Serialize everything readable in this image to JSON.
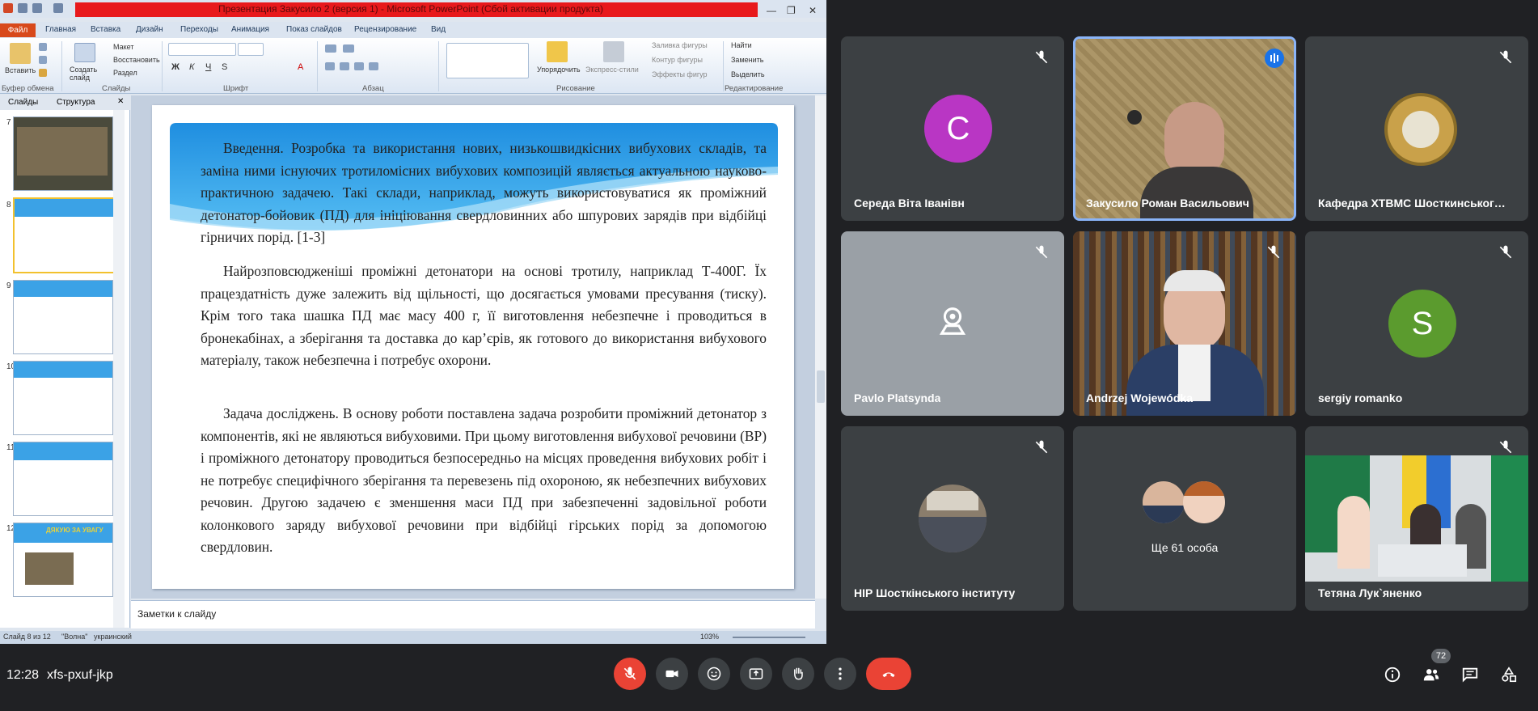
{
  "ppt": {
    "title": "Презентация Закусило 2 (версия 1) - Microsoft PowerPoint (Сбой активации продукта)",
    "file_tab": "Файл",
    "tabs": [
      "Главная",
      "Вставка",
      "Дизайн",
      "Переходы",
      "Анимация",
      "Показ слайдов",
      "Рецензирование",
      "Вид"
    ],
    "ribbon": {
      "paste": "Вставить",
      "new_slide": "Создать слайд",
      "layout": "Макет",
      "reset": "Восстановить",
      "section": "Раздел",
      "arrange": "Упорядочить",
      "quick_styles": "Экспресс-стили",
      "shape_fill": "Заливка фигуры",
      "shape_outline": "Контур фигуры",
      "shape_effects": "Эффекты фигур",
      "find": "Найти",
      "replace": "Заменить",
      "select": "Выделить",
      "groups": {
        "clipboard": "Буфер обмена",
        "slides": "Слайды",
        "font": "Шрифт",
        "paragraph": "Абзац",
        "drawing": "Рисование",
        "editing": "Редактирование"
      }
    },
    "panel_tabs": {
      "slides": "Слайды",
      "outline": "Структура"
    },
    "thumbs": [
      {
        "num": "7"
      },
      {
        "num": "8"
      },
      {
        "num": "9"
      },
      {
        "num": "10"
      },
      {
        "num": "11"
      },
      {
        "num": "12",
        "caption": "ДЯКУЮ ЗА УВАГУ"
      }
    ],
    "slide": {
      "p1_lead": "Введення.",
      "p1": " Розробка та використання нових, низькошвидкісних вибухових складів, та заміна ними існуючих тротиломісних вибухових композицій являється актуальною науково-практичною задачею. Такі склади, наприклад, можуть використовуватися як проміжний детонатор-бойовик (ПД) для ініціювання свердловинних або шпурових зарядів при відбійці гірничих порід. [1-3]",
      "p2": "Найрозповсюдженіші проміжні детонатори на основі тротилу, наприклад Т-400Г. Їх працездатність дуже залежить від  щільності,  що досягається умовами пресування  (тиску). Крім того така шашка ПД має масу 400 г, її виготовлення небезпечне і проводиться в бронекабінах, а зберігання та доставка до кар’єрів, як готового до використання вибухового матеріалу, також небезпечна і потребує охорони.",
      "p3_lead": "Задача досліджень.",
      "p3": " В основу роботи поставлена задача розробити проміжний детонатор з компонентів, які не являються вибуховими. При цьому виготовлення вибухової речовини (ВР) і проміжного детонатору проводиться безпосередньо на місцях проведення вибухових робіт і не потребує специфічного зберігання та перевезень під охороною, як небезпечних вибухових речовин. Другою задачею є зменшення маси ПД при забезпеченні задовільної роботи колонкового заряду вибухової речовини при відбійці гірських порід за допомогою свердловин."
    },
    "notes_placeholder": "Заметки к слайду",
    "status": {
      "slide": "Слайд 8 из 12",
      "theme": "\"Волна\"",
      "lang": "украинский",
      "zoom": "103%"
    }
  },
  "meet": {
    "tiles": [
      {
        "name": "Середа Віта Іванівн",
        "avatar_letter": "C",
        "avatar_color": "#b936c4"
      },
      {
        "name": "Закусило Роман Васильович",
        "speaking": true
      },
      {
        "name": "Кафедра ХТВМС Шосткинського і..."
      },
      {
        "name": "Pavlo Platsynda"
      },
      {
        "name": "Andrzej Wojewódka"
      },
      {
        "name": "sergiy romanko",
        "avatar_letter": "S",
        "avatar_color": "#5b9b2e"
      },
      {
        "name": "НІР Шосткінського інституту"
      },
      {
        "name": "Ще 61 особа"
      },
      {
        "name": "Тетяна Лук`яненко"
      }
    ],
    "time": "12:28",
    "meeting_code": "xfs-pxuf-jkp",
    "participants_count": "72",
    "accent_red": "#ea4335"
  }
}
